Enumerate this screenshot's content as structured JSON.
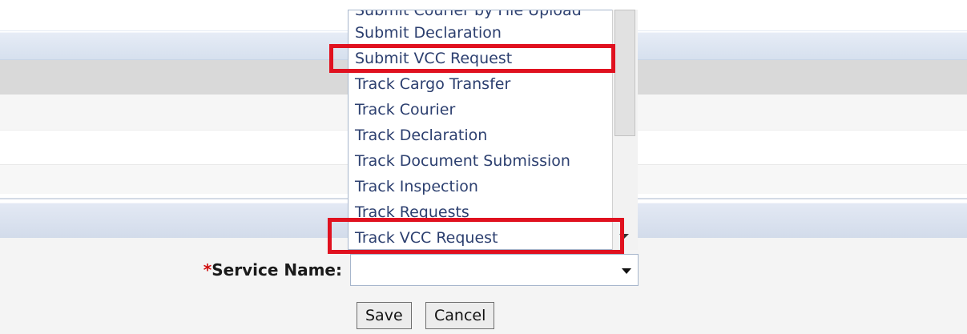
{
  "dropdown": {
    "options": [
      "Submit Courier by File Upload",
      "Submit Declaration",
      "Submit VCC Request",
      "Track Cargo Transfer",
      "Track Courier",
      "Track Declaration",
      "Track Document Submission",
      "Track Inspection",
      "Track Requests",
      "Track VCC Request"
    ],
    "highlighted": [
      "Submit VCC Request",
      "Track VCC Request"
    ],
    "highlight_color": "#e0111f"
  },
  "form": {
    "required_mark": "*",
    "service_name_label": "Service Name:",
    "service_name_value": ""
  },
  "buttons": {
    "save": "Save",
    "cancel": "Cancel"
  }
}
